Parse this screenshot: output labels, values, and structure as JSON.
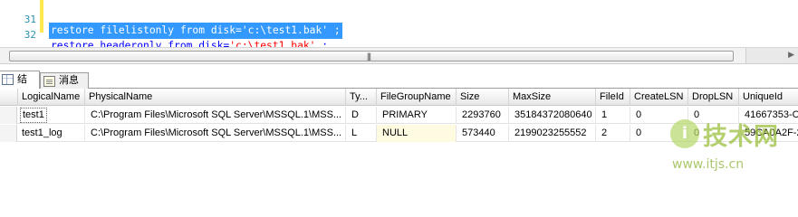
{
  "editor": {
    "lines": [
      {
        "num": "31",
        "parts": [
          {
            "t": "restore filelistonly from disk='c:\\test1.bak' ;",
            "c": "sel"
          }
        ]
      },
      {
        "num": "32",
        "parts": [
          {
            "t": "restore headeronly from disk=",
            "c": "kw"
          },
          {
            "t": "'c:\\test1.bak'",
            "c": "str"
          },
          {
            "t": " ;",
            "c": "kw"
          }
        ]
      }
    ]
  },
  "tabs": {
    "results_label": "结果",
    "messages_label": "消息",
    "results_icon": "grid-icon",
    "messages_icon": "message-icon"
  },
  "results": {
    "columns": [
      "LogicalName",
      "PhysicalName",
      "Ty...",
      "FileGroupName",
      "Size",
      "MaxSize",
      "FileId",
      "CreateLSN",
      "DropLSN",
      "UniqueId"
    ],
    "rows": [
      {
        "num": "1",
        "cells": [
          "test1",
          "C:\\Program Files\\Microsoft SQL Server\\MSSQL.1\\MSS...",
          "D",
          "PRIMARY",
          "2293760",
          "35184372080640",
          "1",
          "0",
          "0",
          "41667353-C"
        ]
      },
      {
        "num": "2",
        "cells": [
          "test1_log",
          "C:\\Program Files\\Microsoft SQL Server\\MSSQL.1\\MSS...",
          "L",
          "NULL",
          "573440",
          "2199023255552",
          "2",
          "0",
          "0",
          "59CA0A2F-2"
        ]
      }
    ]
  },
  "watermark": {
    "title": "技术网",
    "url": "www.itjs.cn"
  },
  "colors": {
    "selection": "#3399ff",
    "keyword": "#0000ff",
    "string": "#ff0000",
    "line_number": "#2b91af",
    "null_cell": "#fffbe0"
  }
}
